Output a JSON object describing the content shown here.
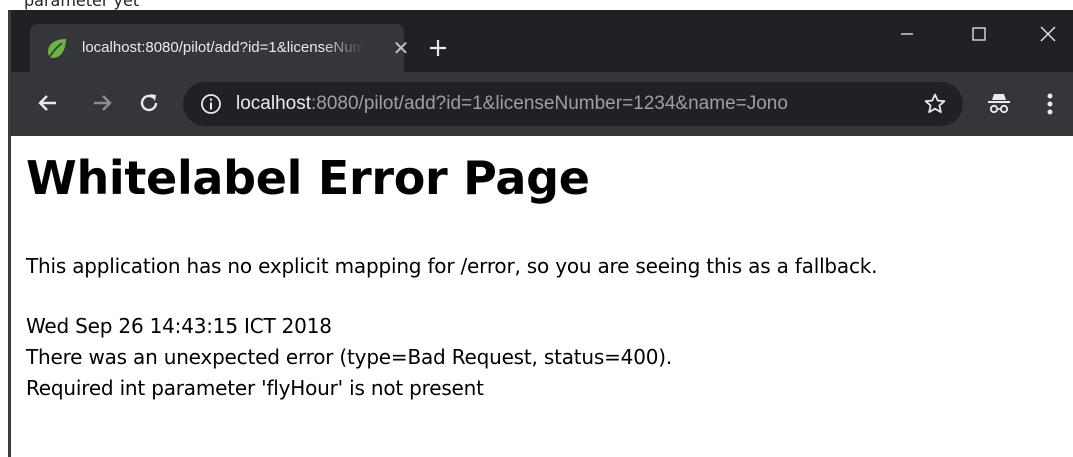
{
  "tab": {
    "title": "localhost:8080/pilot/add?id=1&licenseNumber=1234&name=Jono"
  },
  "address_bar": {
    "host": "localhost",
    "rest": ":8080/pilot/add?id=1&licenseNumber=1234&name=Jono"
  },
  "page": {
    "title": "Whitelabel Error Page",
    "message": "This application has no explicit mapping for /error, so you are seeing this as a fallback.",
    "timestamp": "Wed Sep 26 14:43:15 ICT 2018",
    "error_line": "There was an unexpected error (type=Bad Request, status=400).",
    "detail": "Required int parameter 'flyHour' is not present"
  },
  "top_strip": {
    "text": "parameter yet"
  },
  "icons": {
    "favicon": "spring-leaf-icon",
    "close": "close-icon",
    "new_tab": "plus-icon",
    "back": "arrow-left-icon",
    "forward": "arrow-right-icon",
    "reload": "reload-icon",
    "info": "info-icon",
    "bookmark": "star-icon",
    "incognito": "incognito-icon",
    "menu": "kebab-menu-icon"
  },
  "colors": {
    "titlebar": "#202124",
    "toolbar": "#35363a",
    "omnibox": "#202124",
    "favicon_green": "#6db33f"
  }
}
